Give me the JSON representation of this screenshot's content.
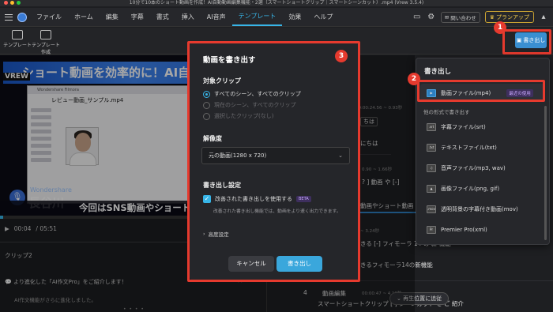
{
  "window": {
    "title": "10分で10本のショート動画を作成！AI自動動画編集機能・2選（スマートショートクリップ｜スマートシーンカット）.mp4 (Vrew 3.5.4)"
  },
  "menubar": {
    "items": [
      "ファイル",
      "ホーム",
      "編集",
      "字幕",
      "書式",
      "挿入",
      "AI音声",
      "テンプレート",
      "効果",
      "ヘルプ"
    ],
    "active_index": 7,
    "contact": "問い合わせ",
    "plan": "プランアップ"
  },
  "toolbar": {
    "template": "テンプレート",
    "template_create_1": "テンプレート",
    "template_create_2": "作成",
    "export": "書き出し"
  },
  "video": {
    "banner": "ショート動画を効率的に！AI自動動",
    "brand": "VREW",
    "inner_header": "Wondershare Filmora",
    "inner_title": "レビュー動画_サンプル.mp4",
    "presenter_company": "Wondershare",
    "presenter_name": "長谷川",
    "subtitle": "今回はSNS動画やショート動画の作"
  },
  "player": {
    "time": "00:04",
    "duration": "/ 05:51"
  },
  "left_bottom": {
    "clip": "クリップ2",
    "notice": "より進化した「AI作文Pro」をご紹介します！",
    "notice_sub": "AI作文機能がさらに進化しました。"
  },
  "editor": {
    "r1_time": "00:00:24.56 ~ 0.93秒",
    "r1_text": "ちは",
    "r2_text": "にちは",
    "r3_time": "0.90 ~ 1.66秒",
    "r3_text": "? ]  動画  や  [-]",
    "r4_text": "動画やショート動画",
    "r5_time": "~ 3.24秒",
    "r5_text": "きる  [-]  フィモーラ  14  の  新  機能",
    "r6_text": "きるフィモーラ14の新機能",
    "row_num": "4",
    "r7_label": "動画編集",
    "r7_time": "00:00:47 ~ 4.10秒",
    "r7_text": "スマートショートクリップ  [-]  シーンカット  を  ご  紹介",
    "position_btn": "再生位置に追従"
  },
  "export_menu": {
    "title": "書き出し",
    "mp4": "動画ファイル(mp4)",
    "recent": "最近の使用",
    "other": "他の形式で書き出す",
    "items": [
      {
        "icon": "srt",
        "label": "字幕ファイル(srt)"
      },
      {
        "icon": "txt",
        "label": "テキストファイル(txt)"
      },
      {
        "icon": "music",
        "label": "音声ファイル(mp3, wav)"
      },
      {
        "icon": "image",
        "label": "画像ファイル(png, gif)"
      },
      {
        "icon": "mov",
        "label": "透明背景の字幕付き動画(mov)"
      },
      {
        "icon": "pr",
        "label": "Premier Pro(xml)"
      }
    ]
  },
  "modal": {
    "title": "動画を書き出す",
    "target_label": "対象クリップ",
    "radios": [
      "すべてのシーン、すべてのクリップ",
      "現在のシーン、すべてのクリップ",
      "選択したクリップ(なし)"
    ],
    "resolution_label": "解像度",
    "resolution_value": "元の動画(1280 x 720)",
    "settings_label": "書き出し設定",
    "improved": "改善された書き出しを使用する",
    "beta": "BETA",
    "desc": "改善された書き出し機能では、動画をより速く出力できます。",
    "advanced": "高度設定",
    "cancel": "キャンセル",
    "export": "書き出し"
  },
  "markers": {
    "m1": "1",
    "m2": "2",
    "m3": "3"
  },
  "colors": {
    "accent": "#37b5e8",
    "annotation_red": "#e63a2e",
    "export_blue": "#3a8fd1"
  }
}
